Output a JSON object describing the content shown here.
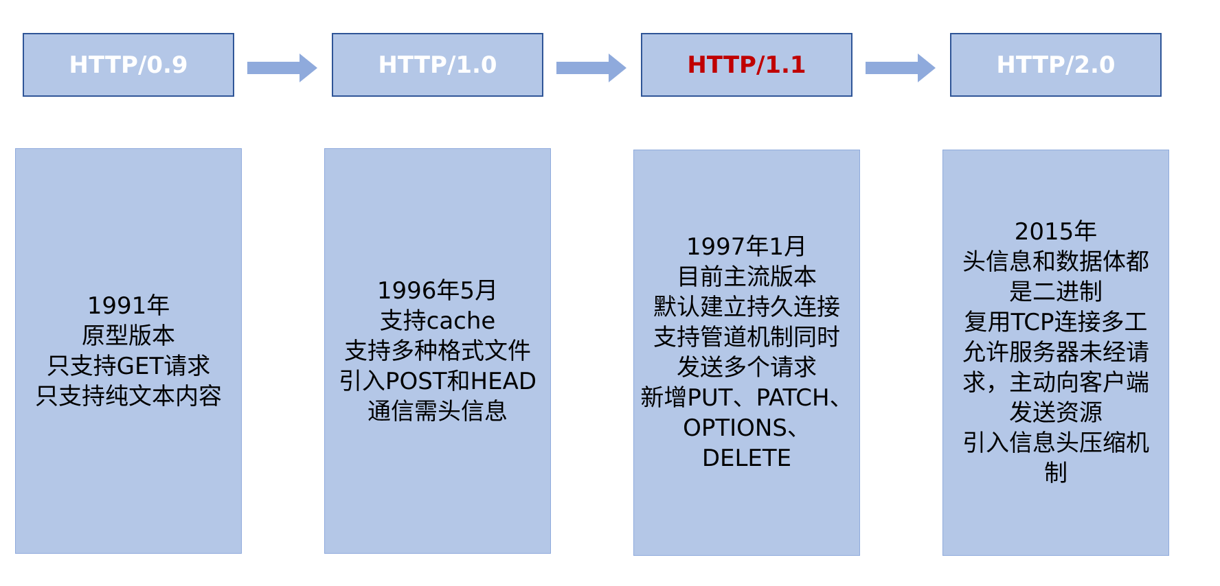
{
  "stages": [
    {
      "version": "HTTP/0.9",
      "lines": [
        "1991年",
        "原型版本",
        "只支持GET请求",
        "只支持纯文本内容"
      ]
    },
    {
      "version": "HTTP/1.0",
      "lines": [
        "1996年5月",
        "支持cache",
        "支持多种格式文件",
        "引入POST和HEAD",
        "通信需头信息"
      ]
    },
    {
      "version": "HTTP/1.1",
      "lines": [
        "1997年1月",
        "目前主流版本",
        "默认建立持久连接",
        "支持管道机制同时",
        "发送多个请求",
        "新增PUT、PATCH、",
        "OPTIONS、DELETE"
      ]
    },
    {
      "version": "HTTP/2.0",
      "lines": [
        "2015年",
        "头信息和数据体都",
        "是二进制",
        "复用TCP连接多工",
        "允许服务器未经请",
        "求，主动向客户端",
        "发送资源",
        "引入信息头压缩机",
        "制"
      ]
    }
  ],
  "colors": {
    "box_fill": "#b4c7e7",
    "header_border": "#2f5597",
    "arrow": "#8faadc",
    "header_text": "#ffffff",
    "highlight_text": "#c00000"
  }
}
